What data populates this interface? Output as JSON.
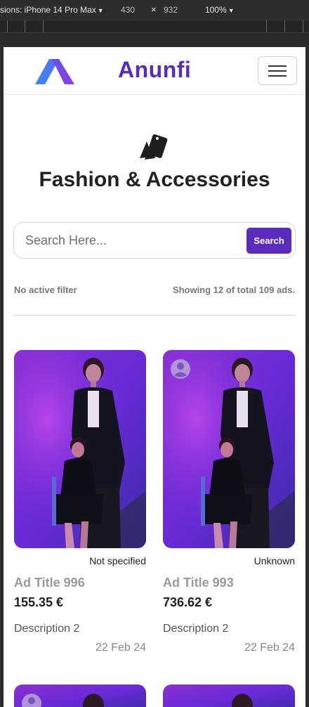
{
  "devtools": {
    "device": "sions: iPhone 14 Pro Max",
    "width": "430",
    "separator": "×",
    "height": "932",
    "zoom": "100%"
  },
  "navbar": {
    "brand": "Anunfi",
    "logo_icon": "anunfi-logo-icon",
    "menu_icon": "hamburger-menu-icon"
  },
  "category": {
    "icon": "fashion-tag-icon",
    "title": "Fashion & Accessories"
  },
  "search": {
    "placeholder": "Search Here...",
    "button_label": "Search"
  },
  "filters": {
    "status": "No active filter",
    "count": "Showing 12 of total 109 ads."
  },
  "colors": {
    "brand": "#5a2bbd",
    "logo_blue": "#3a7bf0",
    "logo_purple": "#7a3fe0"
  },
  "ads": [
    {
      "condition": "Not specified",
      "title": "Ad Title 996",
      "price": "155.35 €",
      "description": "Description 2",
      "date": "22 Feb 24",
      "has_avatar": false
    },
    {
      "condition": "Unknown",
      "title": "Ad Title 993",
      "price": "736.62 €",
      "description": "Description 2",
      "date": "22 Feb 24",
      "has_avatar": true
    }
  ]
}
